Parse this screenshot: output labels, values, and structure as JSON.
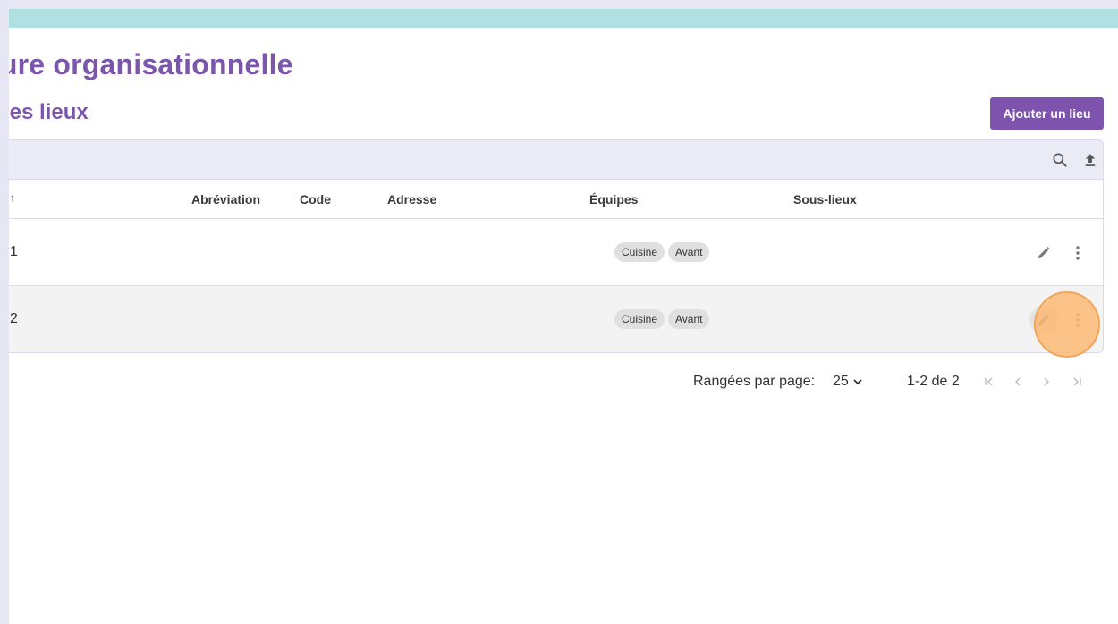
{
  "header": {
    "page_title": "ture organisationnelle",
    "section_title": "des lieux",
    "add_button_label": "Ajouter un lieu"
  },
  "toolbar": {
    "icons": [
      "search-icon",
      "upload-icon"
    ]
  },
  "table": {
    "columns": {
      "name": "",
      "abbreviation": "Abréviation",
      "code": "Code",
      "address": "Adresse",
      "teams": "Équipes",
      "sublocations": "Sous-lieux"
    },
    "rows": [
      {
        "name": "1",
        "teams": [
          "Cuisine",
          "Avant"
        ]
      },
      {
        "name": "2",
        "teams": [
          "Cuisine",
          "Avant"
        ]
      }
    ]
  },
  "pagination": {
    "rows_per_page_label": "Rangées par page:",
    "rows_per_page_value": "25",
    "range_text": "1-2 de 2"
  },
  "colors": {
    "accent": "#7b56ab",
    "banner": "#b1e0e3",
    "highlight": "#fdba74"
  }
}
